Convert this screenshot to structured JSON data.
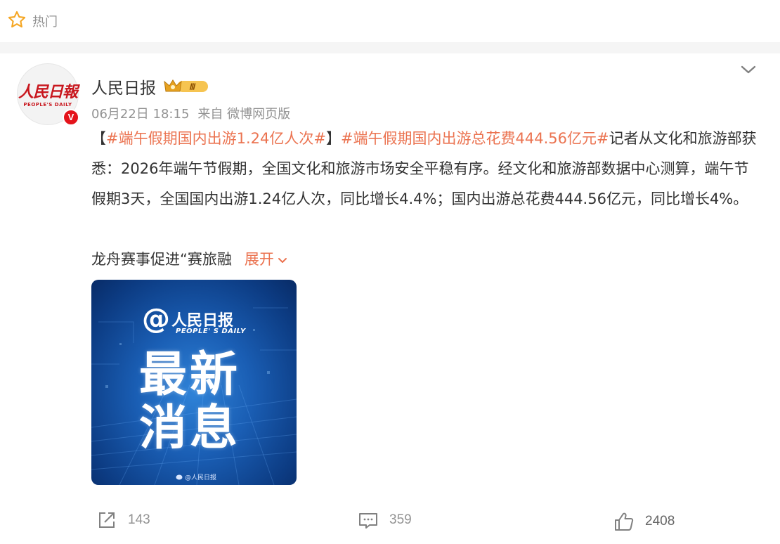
{
  "hot": {
    "label": "热门"
  },
  "post": {
    "author": "人民日报",
    "avatar": {
      "logo_cn": "人民日報",
      "logo_en": "PEOPLE'S DAILY",
      "verified": "V"
    },
    "vip_level": "Ⅲ",
    "date": "06月22日 18:15",
    "source": "来自 微博网页版",
    "text": {
      "bracket_open": "【",
      "tag1": "#端午假期国内出游1.24亿人次#",
      "bracket_close": "】",
      "tag2": "#端午假期国内出游总花费444.56亿元#",
      "body": "记者从文化和旅游部获悉：2026年端午节假期，全国文化和旅游市场安全平稳有序。经文化和旅游部数据中心测算，端午节假期3天，全国国内出游1.24亿人次，同比增长4.4%；国内出游总花费444.56亿元，同比增长4%。"
    },
    "more_text": "龙舟赛事促进“赛旅融",
    "expand_label": "展开",
    "media": {
      "brand_at": "@",
      "brand_name": "人民日报",
      "brand_en": "PEOPLE' S DAILY",
      "headline_line1": "最新",
      "headline_line2": "消息",
      "watermark": "@人民日报"
    }
  },
  "actions": {
    "share_count": "143",
    "comment_count": "359",
    "like_count": "2408"
  },
  "colors": {
    "accent": "#eb7350",
    "muted": "#939393",
    "star": "#f5a623",
    "verified_red": "#e4131b"
  },
  "icons": [
    "star-icon",
    "chevron-down-icon",
    "verified-badge-icon",
    "vip-crown-icon",
    "share-icon",
    "comment-icon",
    "like-icon"
  ]
}
